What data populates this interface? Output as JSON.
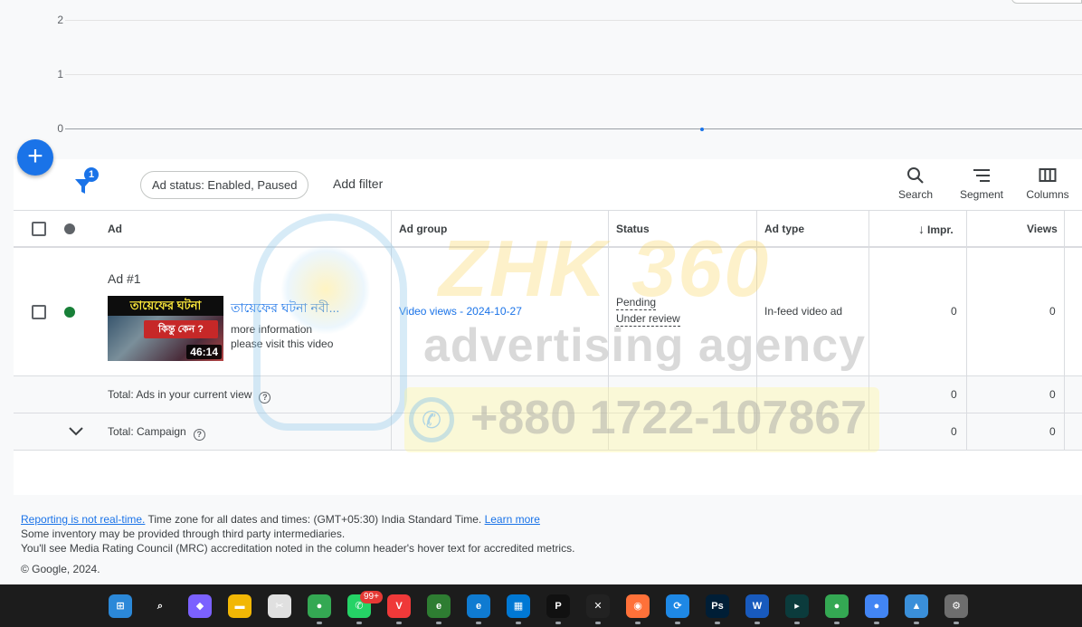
{
  "chart": {
    "y_ticks": [
      "2",
      "1",
      "0"
    ]
  },
  "fab": {
    "label": "+"
  },
  "filter": {
    "badge": "1",
    "chip": "Ad status: Enabled, Paused",
    "add_filter": "Add filter"
  },
  "tools": {
    "search": "Search",
    "segment": "Segment",
    "columns": "Columns"
  },
  "table": {
    "headers": {
      "ad": "Ad",
      "ad_group": "Ad group",
      "status": "Status",
      "ad_type": "Ad type",
      "impr": "Impr.",
      "views": "Views"
    },
    "row": {
      "ad_name": "Ad #1",
      "video_title": "তায়েফের ঘটনা নবী...",
      "desc_1": "more information",
      "desc_2": "please visit this video",
      "thumb_top": "তায়েফের ঘটনা",
      "thumb_mid": "কিন্তু কেন ?",
      "duration": "46:14",
      "ad_group": "Video views - 2024-10-27",
      "status_1": "Pending",
      "status_2": "Under review",
      "ad_type": "In-feed video ad",
      "impr": "0",
      "views": "0",
      "status_color": "#188038"
    },
    "total_view": {
      "label": "Total: Ads in your current view",
      "impr": "0",
      "views": "0"
    },
    "total_campaign": {
      "label": "Total: Campaign",
      "impr": "0",
      "views": "0"
    }
  },
  "watermark": {
    "brand": "ZHK 360",
    "tagline": "advertising agency",
    "phone": "+880 1722-107867"
  },
  "footer": {
    "link_realtime": "Reporting is not real-time.",
    "timezone": " Time zone for all dates and times: (GMT+05:30) India Standard Time. ",
    "learn_more": "Learn more",
    "line2": "Some inventory may be provided through third party intermediaries.",
    "line3": "You'll see Media Rating Council (MRC) accreditation noted in the column header's hover text for accredited metrics.",
    "copyright": "© Google, 2024."
  },
  "taskbar": {
    "badge": "99+",
    "apps": [
      {
        "name": "start",
        "color": "#2b88d8",
        "glyph": "⊞"
      },
      {
        "name": "search",
        "color": "#1c1c1c",
        "glyph": "⌕"
      },
      {
        "name": "copilot",
        "color": "#7b61ff",
        "glyph": "◆"
      },
      {
        "name": "files",
        "color": "#f2b705",
        "glyph": "▬"
      },
      {
        "name": "snip",
        "color": "#e0e0e0",
        "glyph": "✂"
      },
      {
        "name": "chrome",
        "color": "#34a853",
        "glyph": "●"
      },
      {
        "name": "whatsapp",
        "color": "#25d366",
        "glyph": "✆"
      },
      {
        "name": "vivaldi",
        "color": "#ef3939",
        "glyph": "V"
      },
      {
        "name": "edge-dev",
        "color": "#2e7d32",
        "glyph": "e"
      },
      {
        "name": "edge",
        "color": "#0f7bd1",
        "glyph": "e"
      },
      {
        "name": "store",
        "color": "#0078d4",
        "glyph": "▦"
      },
      {
        "name": "app-p",
        "color": "#111111",
        "glyph": "P"
      },
      {
        "name": "capcut",
        "color": "#222222",
        "glyph": "✕"
      },
      {
        "name": "firefox",
        "color": "#ff7139",
        "glyph": "◉"
      },
      {
        "name": "sync",
        "color": "#1e88e5",
        "glyph": "⟳"
      },
      {
        "name": "photoshop",
        "color": "#001e36",
        "glyph": "Ps"
      },
      {
        "name": "word",
        "color": "#185abd",
        "glyph": "W"
      },
      {
        "name": "filmora",
        "color": "#0b3b3c",
        "glyph": "▸"
      },
      {
        "name": "chrome-2",
        "color": "#34a853",
        "glyph": "●"
      },
      {
        "name": "chrome-3",
        "color": "#4285f4",
        "glyph": "●"
      },
      {
        "name": "photos",
        "color": "#3a8fd9",
        "glyph": "▲"
      },
      {
        "name": "settings",
        "color": "#6e6e6e",
        "glyph": "⚙"
      }
    ]
  }
}
